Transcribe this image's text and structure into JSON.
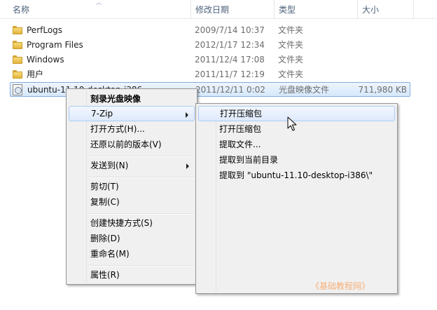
{
  "columns": {
    "name": "名称",
    "date": "修改日期",
    "type": "类型",
    "size": "大小"
  },
  "files": [
    {
      "name": "PerfLogs",
      "date": "2009/7/14 10:37",
      "type": "文件夹",
      "size": "",
      "icon": "folder-icon"
    },
    {
      "name": "Program Files",
      "date": "2012/1/17 12:34",
      "type": "文件夹",
      "size": "",
      "icon": "folder-icon"
    },
    {
      "name": "Windows",
      "date": "2011/12/4 17:08",
      "type": "文件夹",
      "size": "",
      "icon": "folder-icon"
    },
    {
      "name": "用户",
      "date": "2011/11/7 12:19",
      "type": "文件夹",
      "size": "",
      "icon": "folder-icon"
    },
    {
      "name": "ubuntu-11.10-desktop-i386",
      "date": "2011/12/11 0:02",
      "type": "光盘映像文件",
      "size": "711,980 KB",
      "icon": "disc-image-icon",
      "selected": true
    }
  ],
  "context_menu": {
    "items": [
      {
        "label": "刻录光盘映像",
        "bold": true
      },
      {
        "label": "7-Zip",
        "submenu": true,
        "hover": true
      },
      {
        "label": "打开方式(H)..."
      },
      {
        "label": "还原以前的版本(V)"
      },
      {
        "label": "发送到(N)",
        "submenu": true
      },
      {
        "label": "剪切(T)"
      },
      {
        "label": "复制(C)"
      },
      {
        "label": "创建快捷方式(S)"
      },
      {
        "label": "删除(D)"
      },
      {
        "label": "重命名(M)"
      },
      {
        "label": "属性(R)"
      }
    ]
  },
  "zip_submenu": {
    "items": [
      {
        "label": "打开压缩包",
        "hover": true
      },
      {
        "label": "打开压缩包"
      },
      {
        "label": "提取文件..."
      },
      {
        "label": "提取到当前目录"
      },
      {
        "label": "提取到 \"ubuntu-11.10-desktop-i386\\\""
      }
    ]
  },
  "watermark": "《基础教程网》",
  "colors": {
    "selection_border": "#84acdd",
    "hover_border": "#aecbf3",
    "menu_bg": "#f0f0f0",
    "watermark": "#f6b07a"
  }
}
